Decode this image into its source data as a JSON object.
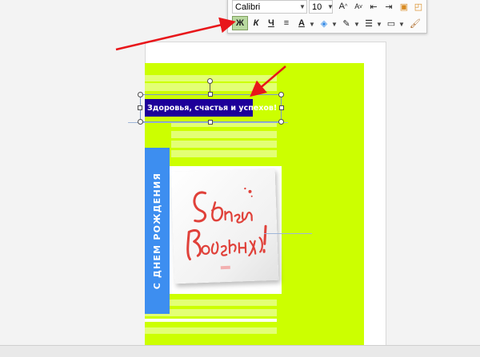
{
  "toolbar": {
    "font_name": "Calibri",
    "font_size": "10",
    "bold_label": "Ж",
    "italic_label": "К",
    "underline_label": "Ч"
  },
  "textbox": {
    "text": "Здоровья, счастья и успехов!"
  },
  "sidebar_strip": {
    "text": "С ДНЕМ РОЖДЕНИЯ"
  },
  "colors": {
    "page_background": "#ccff00",
    "strip": "#3d8ef0",
    "textbox_fill": "#1d0099",
    "annotation_arrow": "#e8161a"
  },
  "icons": [
    "chevron-down-icon",
    "grow-font-icon",
    "shrink-font-icon",
    "decrease-indent-icon",
    "increase-indent-icon",
    "bring-forward-icon",
    "send-backward-icon",
    "align-center-icon",
    "font-color-icon",
    "fill-color-icon",
    "line-color-icon",
    "bullets-icon",
    "wrap-icon",
    "format-painter-icon"
  ]
}
